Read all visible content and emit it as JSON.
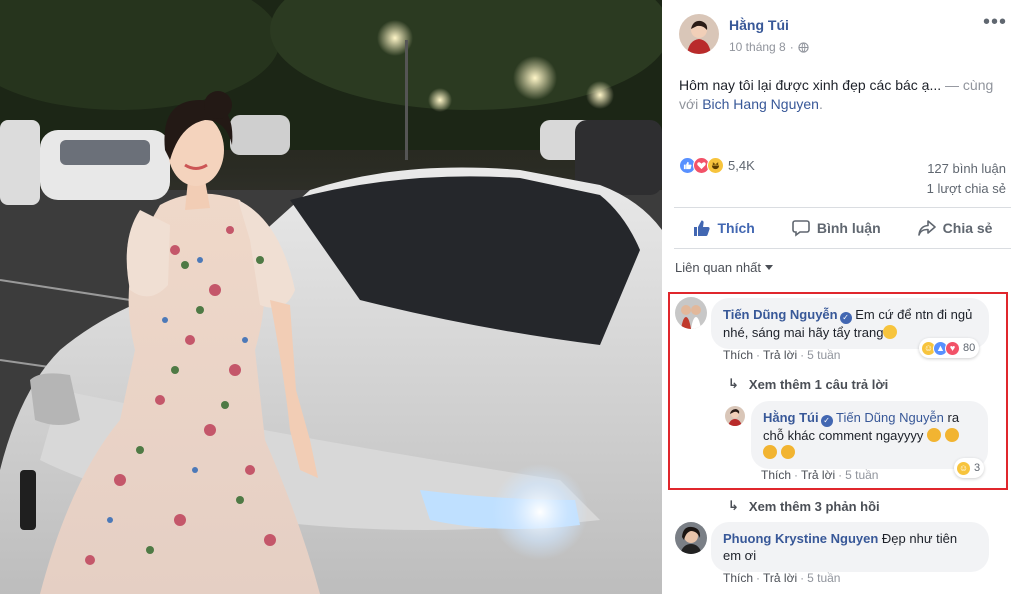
{
  "post": {
    "author": "Hằng Túi",
    "date": "10 tháng 8",
    "text_main": "Hôm nay tôi lại được xinh đẹp các bác ạ...",
    "text_with": " — cùng với ",
    "tagged": "Bich Hang Nguyen",
    "text_end": ".",
    "reaction_count": "5,4K",
    "comments_count": "127 bình luận",
    "shares_count": "1 lượt chia sẻ"
  },
  "actions": {
    "like": "Thích",
    "comment": "Bình luận",
    "share": "Chia sẻ"
  },
  "filter": {
    "label": "Liên quan nhất"
  },
  "comments": [
    {
      "name": "Tiến Dũng Nguyễn",
      "text": "Em cứ để ntn đi ngủ nhé, sáng mai hãy tẩy trang",
      "like": "Thích",
      "reply": "Trả lời",
      "time": "5 tuần",
      "reactions": "80",
      "more": "Xem thêm 1 câu trả lời"
    },
    {
      "name": "Hằng Túi",
      "mention": "Tiến Dũng Nguyễn",
      "text": " ra chỗ khác comment ngayyyy",
      "like": "Thích",
      "reply": "Trả lời",
      "time": "5 tuần",
      "reactions": "3"
    },
    {
      "more": "Xem thêm 3 phản hồi"
    },
    {
      "name": "Phuong Krystine Nguyen",
      "text": " Đẹp như tiên em ơi",
      "like": "Thích",
      "reply": "Trả lời",
      "time": "5 tuần"
    }
  ],
  "colors": {
    "link": "#385898",
    "like_active": "#4267b2",
    "highlight_border": "#e0262c"
  }
}
